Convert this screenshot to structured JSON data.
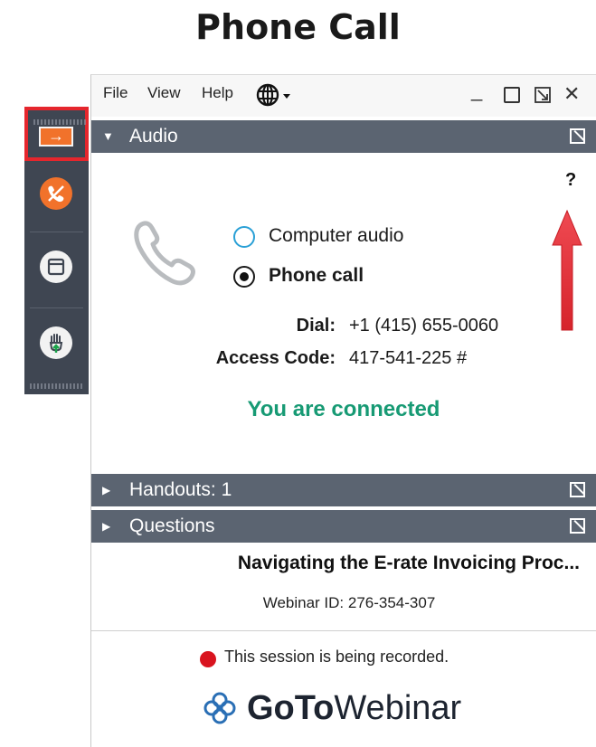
{
  "page_title": "Phone Call",
  "menu": {
    "file": "File",
    "view": "View",
    "help": "Help"
  },
  "window_controls": {
    "minimize": "_",
    "close": "✕"
  },
  "panels": {
    "audio": {
      "label": "Audio",
      "expanded": true
    },
    "handouts": {
      "label": "Handouts: 1",
      "expanded": false
    },
    "questions": {
      "label": "Questions",
      "expanded": false
    }
  },
  "audio": {
    "help_glyph": "?",
    "options": [
      {
        "label": "Computer audio",
        "selected": false
      },
      {
        "label": "Phone call",
        "selected": true
      }
    ],
    "dial_label": "Dial:",
    "dial_value": "+1 (415) 655-0060",
    "access_label": "Access Code:",
    "access_value": "417-541-225 #",
    "status": "You are connected"
  },
  "webinar": {
    "title": "Navigating the E-rate Invoicing Proc...",
    "id_text": "Webinar ID: 276-354-307",
    "recording_text": "This session is being recorded."
  },
  "logo": {
    "part1": "GoTo",
    "part2": "Webinar"
  },
  "colors": {
    "panel_header": "#5b6471",
    "side_tab": "#3f4652",
    "accent_orange": "#f1722b",
    "highlight_red": "#e5262d",
    "connected_green": "#179a74",
    "radio_blue": "#2aa0d6"
  }
}
